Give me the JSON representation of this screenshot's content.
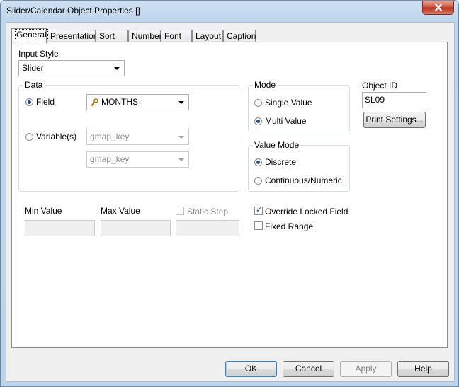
{
  "window": {
    "title": "Slider/Calendar Object Properties []"
  },
  "tabs": [
    {
      "label": "General"
    },
    {
      "label": "Presentation"
    },
    {
      "label": "Sort"
    },
    {
      "label": "Number"
    },
    {
      "label": "Font"
    },
    {
      "label": "Layout"
    },
    {
      "label": "Caption"
    }
  ],
  "input_style": {
    "label": "Input Style",
    "value": "Slider"
  },
  "data_group": {
    "title": "Data",
    "field_label": "Field",
    "field_value": "MONTHS",
    "variables_label": "Variable(s)",
    "variable1": "gmap_key",
    "variable2": "gmap_key"
  },
  "mode_group": {
    "title": "Mode",
    "single": "Single Value",
    "multi": "Multi Value"
  },
  "value_mode_group": {
    "title": "Value Mode",
    "discrete": "Discrete",
    "continuous": "Continuous/Numeric"
  },
  "object_id": {
    "label": "Object ID",
    "value": "SL09"
  },
  "print_settings": "Print Settings...",
  "min_value": {
    "label": "Min Value",
    "value": ""
  },
  "max_value": {
    "label": "Max Value",
    "value": ""
  },
  "static_step": {
    "label": "Static Step",
    "value": ""
  },
  "override_locked": "Override Locked Field",
  "fixed_range": "Fixed Range",
  "buttons": {
    "ok": "OK",
    "cancel": "Cancel",
    "apply": "Apply",
    "help": "Help"
  }
}
